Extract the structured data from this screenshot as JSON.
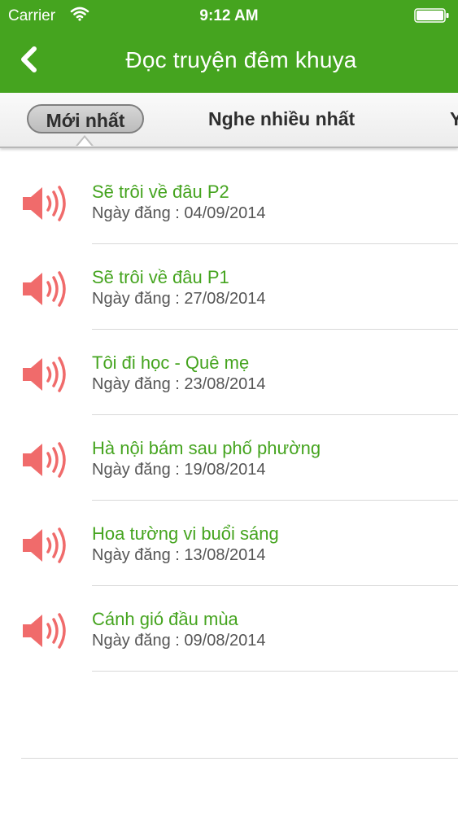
{
  "status": {
    "carrier": "Carrier",
    "time": "9:12 AM"
  },
  "nav": {
    "title": "Đọc truyện đêm khuya"
  },
  "tabs": [
    {
      "label": "Mới nhất",
      "selected": true
    },
    {
      "label": "Nghe nhiều nhất"
    },
    {
      "label": "Y"
    }
  ],
  "items": [
    {
      "title": "Sẽ trôi về đâu P2",
      "date": "Ngày đăng : 04/09/2014"
    },
    {
      "title": "Sẽ trôi về đâu P1",
      "date": "Ngày đăng : 27/08/2014"
    },
    {
      "title": "Tôi đi học - Quê mẹ",
      "date": "Ngày đăng : 23/08/2014"
    },
    {
      "title": "Hà nội bám sau phố phường",
      "date": "Ngày đăng : 19/08/2014"
    },
    {
      "title": "Hoa tường vi buổi sáng",
      "date": "Ngày đăng : 13/08/2014"
    },
    {
      "title": "Cánh gió đầu mùa",
      "date": "Ngày đăng : 09/08/2014"
    }
  ],
  "colors": {
    "brand_green": "#45a41f",
    "speaker_red": "#f06b6b"
  },
  "icons": {
    "back": "chevron-left-icon",
    "speaker": "speaker-icon",
    "wifi": "wifi-icon",
    "battery": "battery-icon"
  }
}
